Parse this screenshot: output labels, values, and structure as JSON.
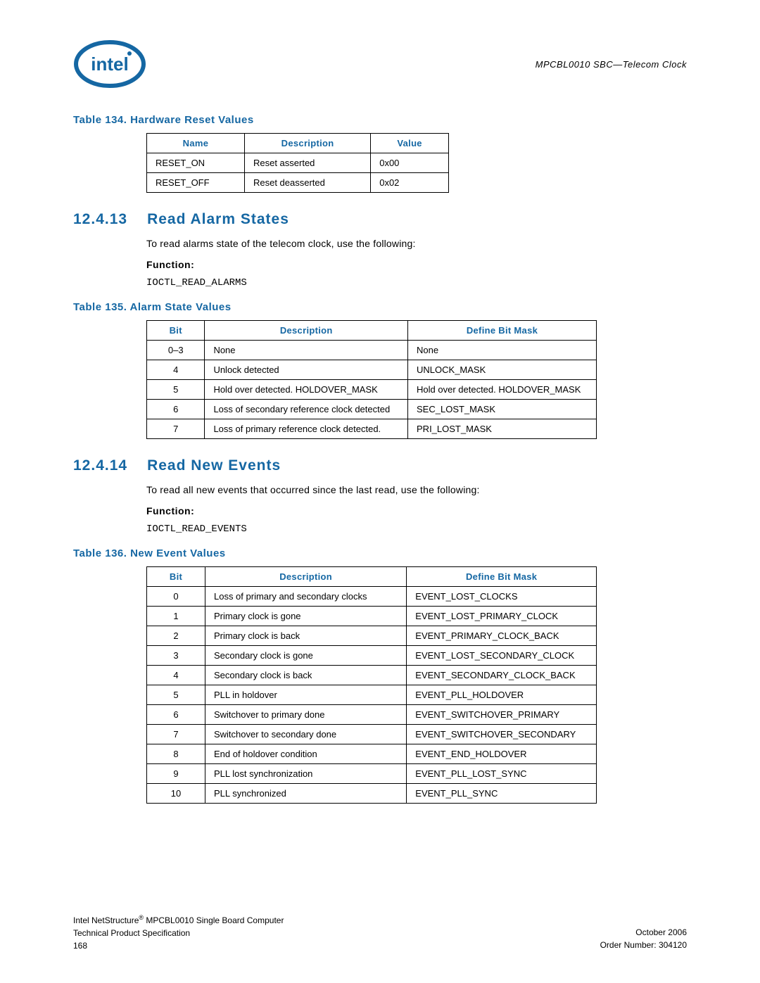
{
  "header": {
    "doc_title": "MPCBL0010 SBC—Telecom Clock"
  },
  "table134": {
    "caption": "Table 134.  Hardware Reset Values",
    "headers": [
      "Name",
      "Description",
      "Value"
    ],
    "rows": [
      [
        "RESET_ON",
        "Reset asserted",
        "0x00"
      ],
      [
        "RESET_OFF",
        "Reset deasserted",
        "0x02"
      ]
    ]
  },
  "section13": {
    "num": "12.4.13",
    "title": "Read Alarm States",
    "body": "To read alarms state of the telecom clock, use the following:",
    "func_label": "Function:",
    "func_code": "IOCTL_READ_ALARMS"
  },
  "table135": {
    "caption": "Table 135.  Alarm State Values",
    "headers": [
      "Bit",
      "Description",
      "Define Bit Mask"
    ],
    "rows": [
      [
        "0–3",
        "None",
        "None"
      ],
      [
        "4",
        "Unlock detected",
        "UNLOCK_MASK"
      ],
      [
        "5",
        "Hold over detected. HOLDOVER_MASK",
        "Hold over detected. HOLDOVER_MASK"
      ],
      [
        "6",
        "Loss of secondary reference clock detected",
        "SEC_LOST_MASK"
      ],
      [
        "7",
        "Loss of primary reference clock detected.",
        "PRI_LOST_MASK"
      ]
    ]
  },
  "section14": {
    "num": "12.4.14",
    "title": "Read New Events",
    "body": "To read all new events that occurred since the last read, use the following:",
    "func_label": "Function:",
    "func_code": "IOCTL_READ_EVENTS"
  },
  "table136": {
    "caption": "Table 136.  New Event Values",
    "headers": [
      "Bit",
      "Description",
      "Define Bit Mask"
    ],
    "rows": [
      [
        "0",
        "Loss of primary and secondary clocks",
        "EVENT_LOST_CLOCKS"
      ],
      [
        "1",
        "Primary clock is gone",
        "EVENT_LOST_PRIMARY_CLOCK"
      ],
      [
        "2",
        "Primary clock is back",
        "EVENT_PRIMARY_CLOCK_BACK"
      ],
      [
        "3",
        "Secondary clock is gone",
        "EVENT_LOST_SECONDARY_CLOCK"
      ],
      [
        "4",
        "Secondary clock is back",
        "EVENT_SECONDARY_CLOCK_BACK"
      ],
      [
        "5",
        "PLL in holdover",
        "EVENT_PLL_HOLDOVER"
      ],
      [
        "6",
        "Switchover to primary done",
        "EVENT_SWITCHOVER_PRIMARY"
      ],
      [
        "7",
        "Switchover to secondary done",
        "EVENT_SWITCHOVER_SECONDARY"
      ],
      [
        "8",
        "End of holdover condition",
        "EVENT_END_HOLDOVER"
      ],
      [
        "9",
        "PLL lost synchronization",
        "EVENT_PLL_LOST_SYNC"
      ],
      [
        "10",
        "PLL synchronized",
        "EVENT_PLL_SYNC"
      ]
    ]
  },
  "footer": {
    "left1_a": "Intel NetStructure",
    "left1_b": " MPCBL0010 Single Board Computer",
    "left2": "Technical Product Specification",
    "left3": "168",
    "right1": "October 2006",
    "right2": "Order Number: 304120"
  }
}
